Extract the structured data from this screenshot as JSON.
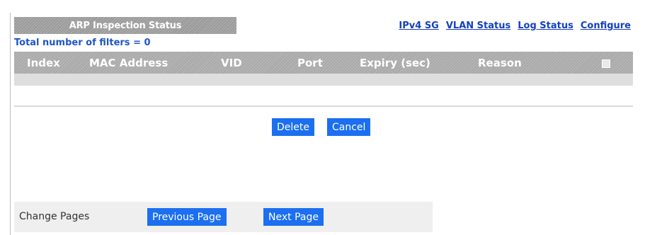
{
  "header": {
    "title": "ARP Inspection Status",
    "nav": [
      "IPv4 SG",
      "VLAN Status",
      "Log Status",
      "Configure"
    ]
  },
  "summary": {
    "total_filters": "Total number of filters = 0"
  },
  "table": {
    "columns": [
      "Index",
      "MAC Address",
      "VID",
      "Port",
      "Expiry (sec)",
      "Reason"
    ],
    "rows": []
  },
  "actions": {
    "delete": "Delete",
    "cancel": "Cancel"
  },
  "pager": {
    "label": "Change Pages",
    "previous": "Previous Page",
    "next": "Next Page"
  },
  "colors": {
    "link": "#1540c0",
    "button": "#1b6ff0",
    "header_bg": "#a9a9a9"
  }
}
